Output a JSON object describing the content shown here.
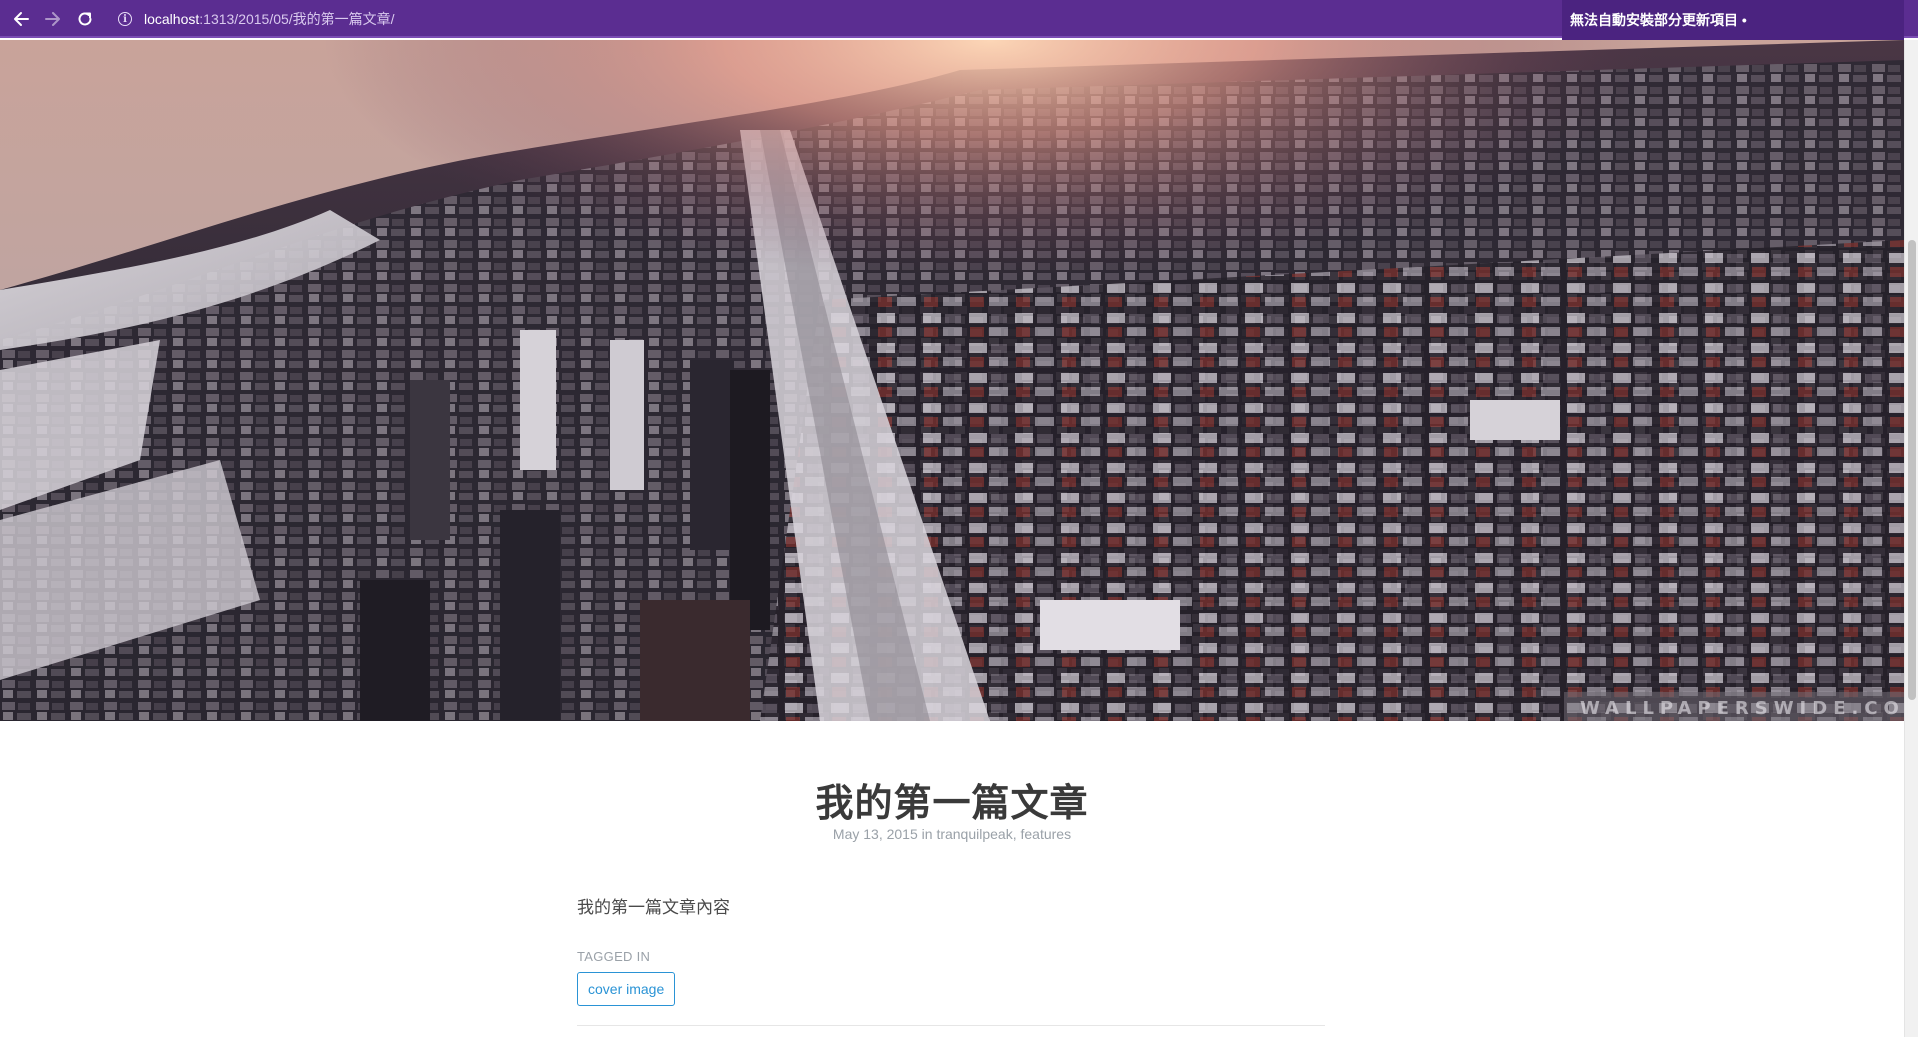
{
  "browser": {
    "url_host": "localhost",
    "url_path": ":1313/2015/05/我的第一篇文章/",
    "update_notice": "無法自動安裝部分更新項目 •",
    "icons": [
      "back-arrow-icon",
      "forward-arrow-icon",
      "reload-icon",
      "info-icon"
    ]
  },
  "cover": {
    "watermark": "WALLPAPERSWIDE.COM"
  },
  "post": {
    "title": "我的第一篇文章",
    "date": "May 13, 2015",
    "in_word": "in",
    "categories": [
      "tranquilpeak",
      "features"
    ],
    "body": "我的第一篇文章內容",
    "tagged_in_label": "TAGGED IN",
    "tags": [
      "cover image"
    ]
  },
  "colors": {
    "toolbar": "#5b2d91",
    "tag_accent": "#2a93d5",
    "title": "#3a3a3a",
    "meta": "#9aa1a8"
  }
}
